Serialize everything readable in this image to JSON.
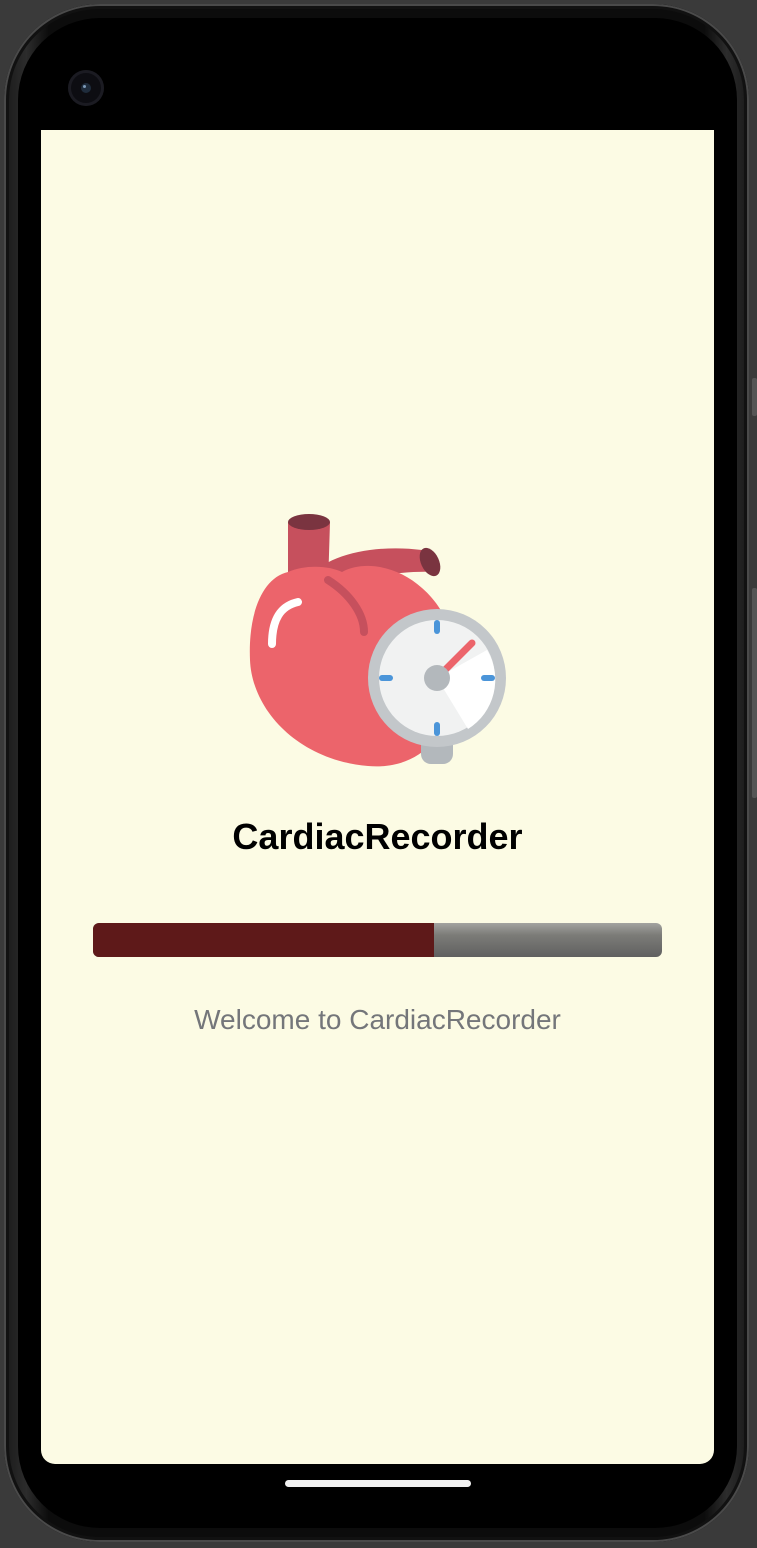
{
  "app": {
    "title": "CardiacRecorder",
    "logo_icon": "heart-with-pressure-gauge-icon",
    "background_color": "#fcfbe4"
  },
  "splash": {
    "welcome_text": "Welcome to CardiacRecorder",
    "progress_value": 0.6,
    "progress_fill_color": "#5e1919",
    "progress_track_color": "#7c7c78"
  },
  "device": {
    "camera_icon": "front-camera-icon",
    "home_indicator_icon": "home-gesture-bar"
  }
}
